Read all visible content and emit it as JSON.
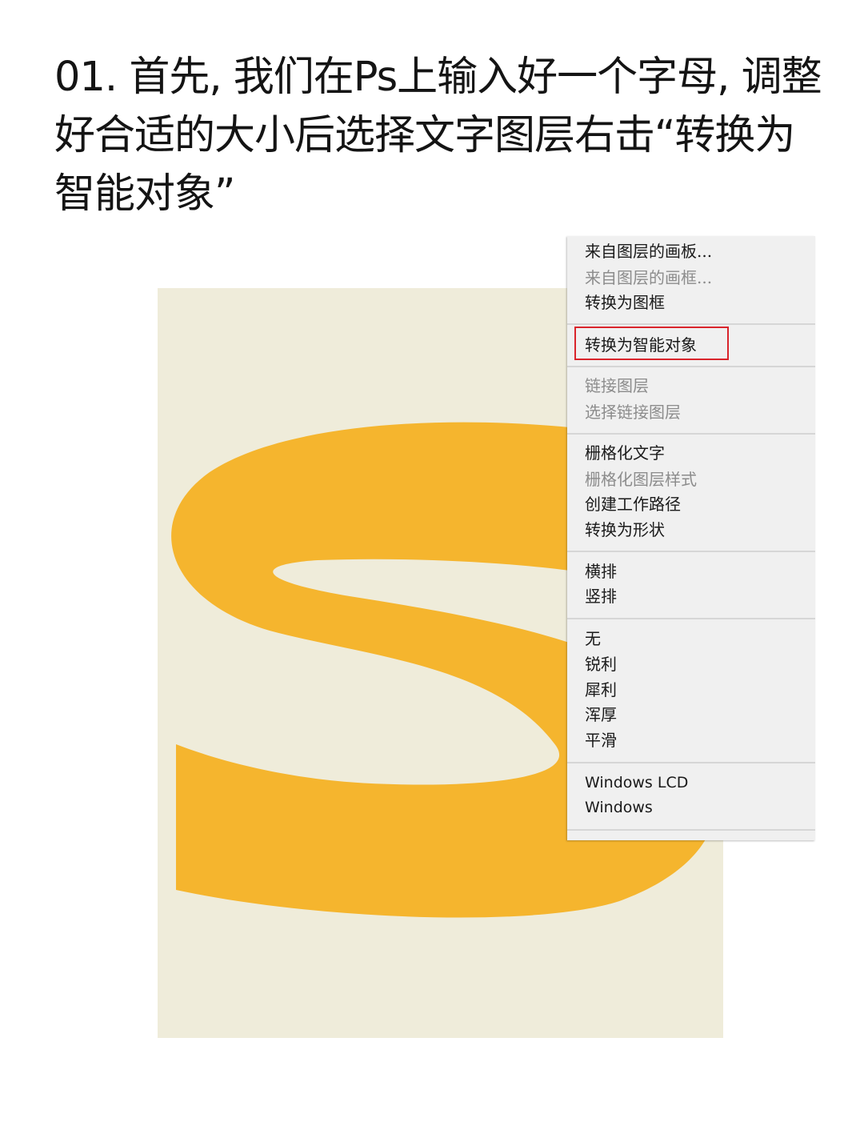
{
  "title": "01. 首先, 我们在Ps上输入好一个字母, 调整好合适的大小后选择文字图层右击“转换为智能对象”",
  "colors": {
    "canvas_bg": "#efecda",
    "letter": "#f5b52e",
    "highlight": "#d9242b",
    "menu_bg": "#f0f0f0"
  },
  "context_menu": {
    "items": [
      {
        "label": "来自图层的画板...",
        "disabled": false
      },
      {
        "label": "来自图层的画框...",
        "disabled": true
      },
      {
        "label": "转换为图框",
        "disabled": false
      },
      {
        "label": "转换为智能对象",
        "disabled": false,
        "highlighted": true
      },
      {
        "label": "链接图层",
        "disabled": true
      },
      {
        "label": "选择链接图层",
        "disabled": true
      },
      {
        "label": "栅格化文字",
        "disabled": false
      },
      {
        "label": "栅格化图层样式",
        "disabled": true
      },
      {
        "label": "创建工作路径",
        "disabled": false
      },
      {
        "label": "转换为形状",
        "disabled": false
      },
      {
        "label": "横排",
        "disabled": false
      },
      {
        "label": "竖排",
        "disabled": false
      },
      {
        "label": "无",
        "disabled": false
      },
      {
        "label": "锐利",
        "disabled": false
      },
      {
        "label": "犀利",
        "disabled": false
      },
      {
        "label": "浑厚",
        "disabled": false
      },
      {
        "label": "平滑",
        "disabled": false
      },
      {
        "label": "Windows LCD",
        "disabled": false
      },
      {
        "label": "Windows",
        "disabled": false
      }
    ]
  }
}
